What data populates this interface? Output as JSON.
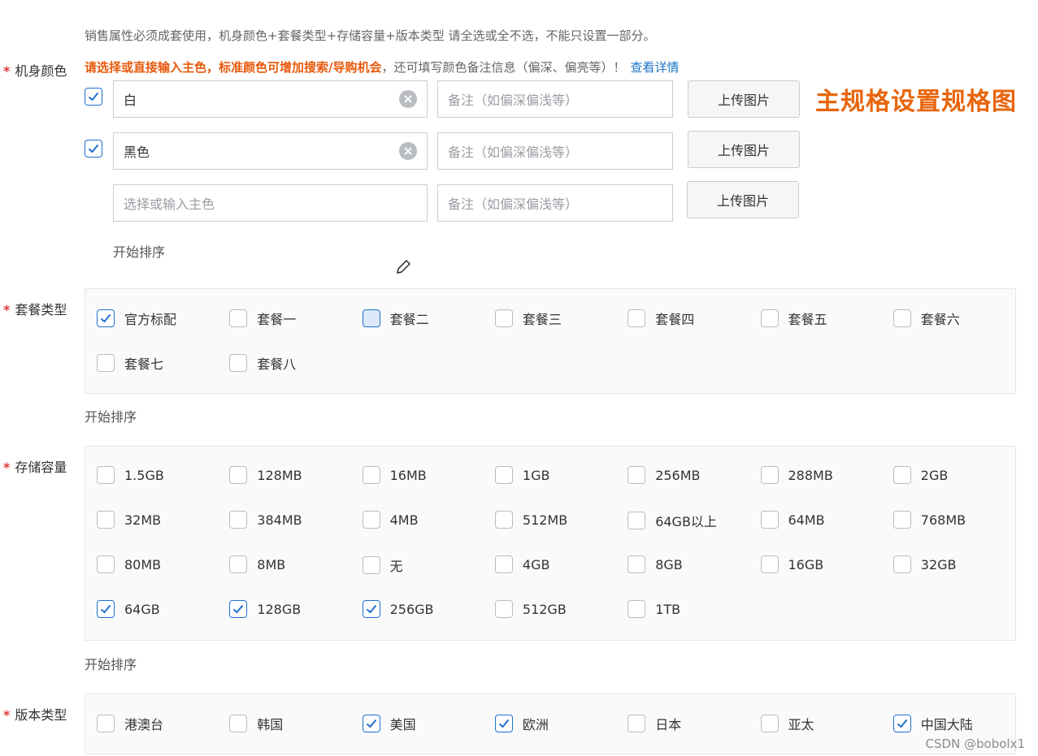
{
  "notice": "销售属性必须成套使用，机身颜色+套餐类型+存储容量+版本类型 请全选或全不选，不能只设置一部分。",
  "required_mark": "*",
  "color_section": {
    "label": "机身颜色",
    "hint_warning": "请选择或直接输入主色，标准颜色可增加搜索/导购机会",
    "hint_rest": "，还可填写颜色备注信息（偏深、偏亮等）！",
    "hint_link": "查看详情",
    "callout": "主规格设置规格图",
    "rows": [
      {
        "checked": true,
        "value": "白",
        "remark_placeholder": "备注（如偏深偏浅等）",
        "upload_label": "上传图片"
      },
      {
        "checked": true,
        "value": "黑色",
        "remark_placeholder": "备注（如偏深偏浅等）",
        "upload_label": "上传图片"
      },
      {
        "checked": false,
        "value_placeholder": "选择或输入主色",
        "remark_placeholder": "备注（如偏深偏浅等）",
        "upload_label": "上传图片"
      }
    ],
    "sort_label": "开始排序"
  },
  "package_section": {
    "label": "套餐类型",
    "options": [
      {
        "label": "官方标配",
        "checked": true
      },
      {
        "label": "套餐一",
        "checked": false
      },
      {
        "label": "套餐二",
        "checked": false,
        "hover": true
      },
      {
        "label": "套餐三",
        "checked": false
      },
      {
        "label": "套餐四",
        "checked": false
      },
      {
        "label": "套餐五",
        "checked": false
      },
      {
        "label": "套餐六",
        "checked": false
      },
      {
        "label": "套餐七",
        "checked": false
      },
      {
        "label": "套餐八",
        "checked": false
      }
    ],
    "sort_label": "开始排序"
  },
  "storage_section": {
    "label": "存储容量",
    "options": [
      {
        "label": "1.5GB",
        "checked": false
      },
      {
        "label": "128MB",
        "checked": false
      },
      {
        "label": "16MB",
        "checked": false
      },
      {
        "label": "1GB",
        "checked": false
      },
      {
        "label": "256MB",
        "checked": false
      },
      {
        "label": "288MB",
        "checked": false
      },
      {
        "label": "2GB",
        "checked": false
      },
      {
        "label": "32MB",
        "checked": false
      },
      {
        "label": "384MB",
        "checked": false
      },
      {
        "label": "4MB",
        "checked": false
      },
      {
        "label": "512MB",
        "checked": false
      },
      {
        "label": "64GB以上",
        "checked": false
      },
      {
        "label": "64MB",
        "checked": false
      },
      {
        "label": "768MB",
        "checked": false
      },
      {
        "label": "80MB",
        "checked": false
      },
      {
        "label": "8MB",
        "checked": false
      },
      {
        "label": "无",
        "checked": false
      },
      {
        "label": "4GB",
        "checked": false
      },
      {
        "label": "8GB",
        "checked": false
      },
      {
        "label": "16GB",
        "checked": false
      },
      {
        "label": "32GB",
        "checked": false
      },
      {
        "label": "64GB",
        "checked": true
      },
      {
        "label": "128GB",
        "checked": true
      },
      {
        "label": "256GB",
        "checked": true
      },
      {
        "label": "512GB",
        "checked": false
      },
      {
        "label": "1TB",
        "checked": false
      }
    ],
    "sort_label": "开始排序"
  },
  "version_section": {
    "label": "版本类型",
    "options": [
      {
        "label": "港澳台",
        "checked": false
      },
      {
        "label": "韩国",
        "checked": false
      },
      {
        "label": "美国",
        "checked": true
      },
      {
        "label": "欧洲",
        "checked": true
      },
      {
        "label": "日本",
        "checked": false
      },
      {
        "label": "亚太",
        "checked": false
      },
      {
        "label": "中国大陆",
        "checked": true
      }
    ]
  },
  "watermark": "CSDN @bobolx1",
  "colors": {
    "accent": "#1f6fd1",
    "warning": "#e8590c",
    "required": "#e4393c",
    "link": "#1a73c8"
  },
  "icons": {
    "clear": "clear-circle-icon",
    "check": "checkmark-icon",
    "cursor": "pencil-cursor-icon"
  }
}
